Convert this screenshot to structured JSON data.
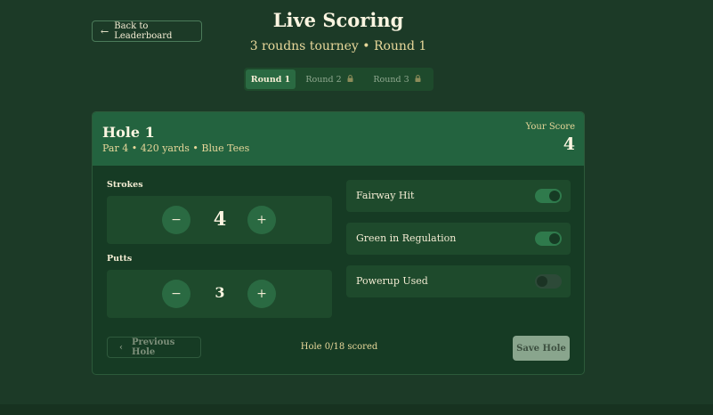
{
  "header": {
    "back_label": "Back to Leaderboard",
    "title": "Live Scoring",
    "subtitle": "3 roudns tourney • Round 1"
  },
  "tabs": [
    {
      "label": "Round 1",
      "locked": false,
      "active": true
    },
    {
      "label": "Round 2",
      "locked": true,
      "active": false
    },
    {
      "label": "Round 3",
      "locked": true,
      "active": false
    }
  ],
  "hole": {
    "title": "Hole 1",
    "info": "Par 4 • 420 yards • Blue Tees",
    "score_label": "Your Score",
    "score_value": "4"
  },
  "strokes": {
    "label": "Strokes",
    "value": "4",
    "minus": "−",
    "plus": "+"
  },
  "putts": {
    "label": "Putts",
    "value": "3",
    "minus": "−",
    "plus": "+"
  },
  "toggles": [
    {
      "label": "Fairway Hit",
      "on": true
    },
    {
      "label": "Green in Regulation",
      "on": true
    },
    {
      "label": "Powerup Used",
      "on": false
    }
  ],
  "footer": {
    "prev_label": "Previous Hole",
    "prev_icon": "‹",
    "progress": "Hole 0/18 scored",
    "save_label": "Save Hole"
  },
  "icons": {
    "back": "←",
    "lock": "🔒"
  },
  "colors": {
    "background": "#1c3a27",
    "accent": "#23633f",
    "gold": "#e7d79a"
  }
}
